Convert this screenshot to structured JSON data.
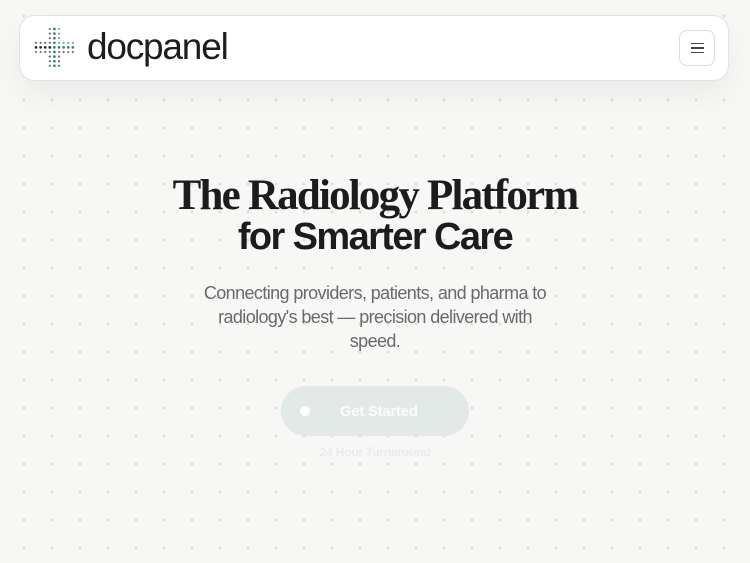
{
  "header": {
    "brand_name": "docpanel",
    "logo_icon": "dot-matrix-cross-logo",
    "menu_icon": "hamburger-menu-icon"
  },
  "hero": {
    "headline_line1": "The Radiology Platform",
    "headline_line2": "for Smarter Care",
    "subtitle": "Connecting providers, patients, and pharma to radiology's best — precision delivered with speed.",
    "cta_label": "Get Started",
    "turnaround_note": "24 Hour Turnaround"
  },
  "colors": {
    "logo_green": "#2e8a63",
    "logo_dark": "#2b2b2b",
    "cta_background": "#e3e9e7",
    "page_background": "#f7f7f6"
  }
}
